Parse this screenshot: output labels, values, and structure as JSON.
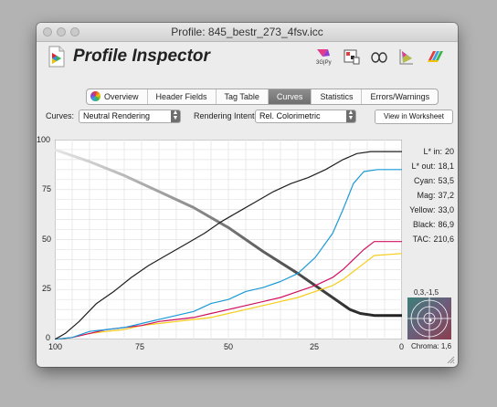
{
  "window": {
    "title": "Profile: 845_bestr_273_4fsv.icc"
  },
  "app": {
    "title": "Profile Inspector"
  },
  "toolbar_icons": [
    "3d-gamut-icon",
    "tag-view-icon",
    "glasses-icon",
    "gamut-triangle-icon",
    "color-bars-icon"
  ],
  "tabs": [
    {
      "label": "Overview",
      "icon": "colorwheel-icon",
      "active": false
    },
    {
      "label": "Header Fields",
      "active": false
    },
    {
      "label": "Tag Table",
      "active": false
    },
    {
      "label": "Curves",
      "active": true
    },
    {
      "label": "Statistics",
      "active": false
    },
    {
      "label": "Errors/Warnings",
      "active": false
    }
  ],
  "controls": {
    "curves_label": "Curves:",
    "curves_value": "Neutral Rendering",
    "intent_label": "Rendering Intent:",
    "intent_value": "Rel. Colorimetric",
    "worksheet_button": "View in Worksheet"
  },
  "info": {
    "lstar_in_label": "L* in:",
    "lstar_in": "20",
    "lstar_out_label": "L* out:",
    "lstar_out": "18,1",
    "cyan_label": "Cyan:",
    "cyan": "53,5",
    "mag_label": "Mag:",
    "mag": "37,2",
    "yellow_label": "Yellow:",
    "yellow": "33,0",
    "black_label": "Black:",
    "black": "86,9",
    "tac_label": "TAC:",
    "tac": "210,6"
  },
  "chroma": {
    "coords": "0,3,-1,5",
    "label": "Chroma:",
    "value": "1,6"
  },
  "chart_data": {
    "type": "line",
    "x_ticks": [
      "100",
      "75",
      "50",
      "25",
      "0"
    ],
    "y_ticks": [
      "100",
      "75",
      "50",
      "25",
      "0"
    ],
    "xlim": [
      100,
      0
    ],
    "ylim": [
      0,
      100
    ],
    "grid": true,
    "colors": {
      "cyan": "#1a9ad6",
      "magenta": "#d0105e",
      "yellow": "#f6cd18",
      "black": "#1f1f1f",
      "lstar": "#555555"
    },
    "series": [
      {
        "key": "black",
        "points": [
          [
            100,
            0
          ],
          [
            97,
            3
          ],
          [
            93,
            9
          ],
          [
            88,
            18
          ],
          [
            83,
            24
          ],
          [
            78,
            31
          ],
          [
            73,
            37
          ],
          [
            68,
            42
          ],
          [
            63,
            47
          ],
          [
            57,
            53
          ],
          [
            52,
            59
          ],
          [
            47,
            64
          ],
          [
            42,
            69
          ],
          [
            37,
            74
          ],
          [
            32,
            78
          ],
          [
            27,
            81
          ],
          [
            22,
            85
          ],
          [
            17,
            90
          ],
          [
            13,
            93
          ],
          [
            9,
            94
          ],
          [
            5,
            94
          ],
          [
            0,
            94
          ]
        ]
      },
      {
        "key": "cyan",
        "points": [
          [
            100,
            0
          ],
          [
            95,
            1
          ],
          [
            90,
            4
          ],
          [
            85,
            5
          ],
          [
            80,
            6
          ],
          [
            75,
            8
          ],
          [
            70,
            10
          ],
          [
            65,
            12
          ],
          [
            60,
            14
          ],
          [
            55,
            18
          ],
          [
            50,
            20
          ],
          [
            45,
            24
          ],
          [
            40,
            26
          ],
          [
            35,
            29
          ],
          [
            30,
            33
          ],
          [
            25,
            41
          ],
          [
            20,
            53
          ],
          [
            17,
            65
          ],
          [
            14,
            78
          ],
          [
            11,
            84
          ],
          [
            7,
            85
          ],
          [
            0,
            85
          ]
        ]
      },
      {
        "key": "magenta",
        "points": [
          [
            100,
            0
          ],
          [
            95,
            1
          ],
          [
            90,
            3
          ],
          [
            85,
            5
          ],
          [
            80,
            6
          ],
          [
            75,
            7
          ],
          [
            70,
            9
          ],
          [
            65,
            10
          ],
          [
            60,
            11
          ],
          [
            55,
            13
          ],
          [
            50,
            15
          ],
          [
            45,
            17
          ],
          [
            40,
            19
          ],
          [
            35,
            21
          ],
          [
            30,
            24
          ],
          [
            25,
            27
          ],
          [
            20,
            31
          ],
          [
            17,
            35
          ],
          [
            14,
            40
          ],
          [
            11,
            45
          ],
          [
            8,
            49
          ],
          [
            0,
            49
          ]
        ]
      },
      {
        "key": "yellow",
        "points": [
          [
            100,
            0
          ],
          [
            95,
            1
          ],
          [
            90,
            3
          ],
          [
            85,
            4
          ],
          [
            80,
            5
          ],
          [
            75,
            7
          ],
          [
            70,
            8
          ],
          [
            65,
            9
          ],
          [
            60,
            10
          ],
          [
            55,
            11
          ],
          [
            50,
            13
          ],
          [
            45,
            15
          ],
          [
            40,
            17
          ],
          [
            35,
            19
          ],
          [
            30,
            21
          ],
          [
            25,
            24
          ],
          [
            20,
            27
          ],
          [
            17,
            30
          ],
          [
            14,
            34
          ],
          [
            11,
            38
          ],
          [
            8,
            42
          ],
          [
            0,
            43
          ]
        ]
      },
      {
        "key": "lstar",
        "points": [
          [
            100,
            95
          ],
          [
            90,
            89
          ],
          [
            80,
            82
          ],
          [
            70,
            74
          ],
          [
            60,
            66
          ],
          [
            50,
            56
          ],
          [
            40,
            44
          ],
          [
            30,
            33
          ],
          [
            25,
            27
          ],
          [
            20,
            21
          ],
          [
            15,
            15
          ],
          [
            12,
            13
          ],
          [
            8,
            12
          ],
          [
            0,
            12
          ]
        ]
      }
    ]
  }
}
